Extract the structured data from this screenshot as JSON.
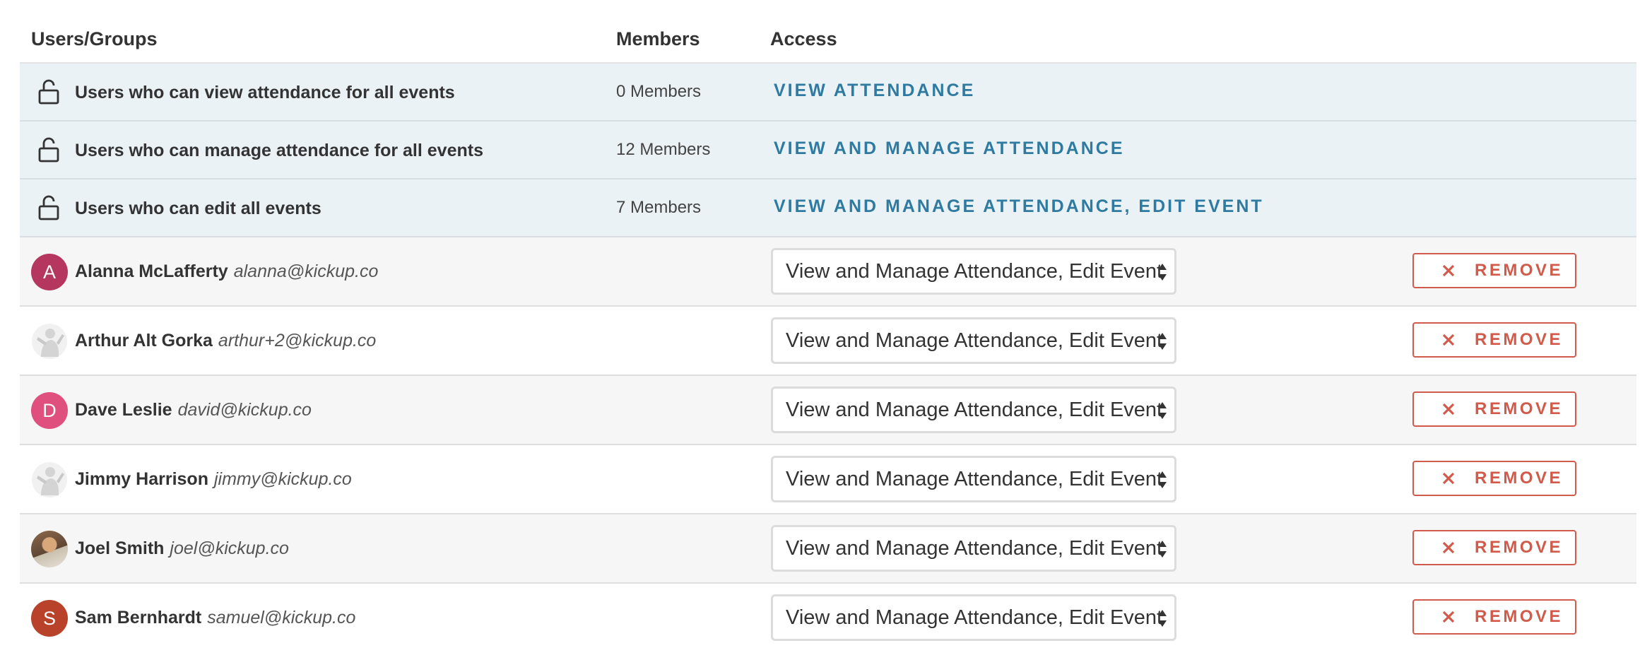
{
  "header": {
    "users_groups": "Users/Groups",
    "members": "Members",
    "access": "Access"
  },
  "groups": [
    {
      "name": "Users who can view attendance for all events",
      "members": "0 Members",
      "access": "VIEW ATTENDANCE",
      "icon": "unlocked-padlock-icon"
    },
    {
      "name": "Users who can manage attendance for all events",
      "members": "12 Members",
      "access": "VIEW AND MANAGE ATTENDANCE",
      "icon": "unlocked-padlock-icon"
    },
    {
      "name": "Users who can edit all events",
      "members": "7 Members",
      "access": "VIEW AND MANAGE ATTENDANCE, EDIT EVENT",
      "icon": "unlocked-padlock-icon"
    }
  ],
  "users": [
    {
      "name": "Alanna McLafferty",
      "email": "alanna@kickup.co",
      "avatar_initial": "A",
      "avatar_color": "#b5375f",
      "access": "View and Manage Attendance, Edit Event",
      "remove_label": "REMOVE"
    },
    {
      "name": "Arthur Alt Gorka",
      "email": "arthur+2@kickup.co",
      "avatar_initial": "",
      "avatar_color": "",
      "access": "View and Manage Attendance, Edit Event",
      "remove_label": "REMOVE"
    },
    {
      "name": "Dave Leslie",
      "email": "david@kickup.co",
      "avatar_initial": "D",
      "avatar_color": "#e0507e",
      "access": "View and Manage Attendance, Edit Event",
      "remove_label": "REMOVE"
    },
    {
      "name": "Jimmy Harrison",
      "email": "jimmy@kickup.co",
      "avatar_initial": "",
      "avatar_color": "",
      "access": "View and Manage Attendance, Edit Event",
      "remove_label": "REMOVE"
    },
    {
      "name": "Joel Smith",
      "email": "joel@kickup.co",
      "avatar_initial": "",
      "avatar_color": "",
      "access": "View and Manage Attendance, Edit Event",
      "remove_label": "REMOVE"
    },
    {
      "name": "Sam Bernhardt",
      "email": "samuel@kickup.co",
      "avatar_initial": "S",
      "avatar_color": "#b9432a",
      "access": "View and Manage Attendance, Edit Event",
      "remove_label": "REMOVE"
    }
  ],
  "colors": {
    "group_row_bg": "#eaf2f6",
    "access_link": "#2f7aa0",
    "remove": "#d15a4a"
  }
}
